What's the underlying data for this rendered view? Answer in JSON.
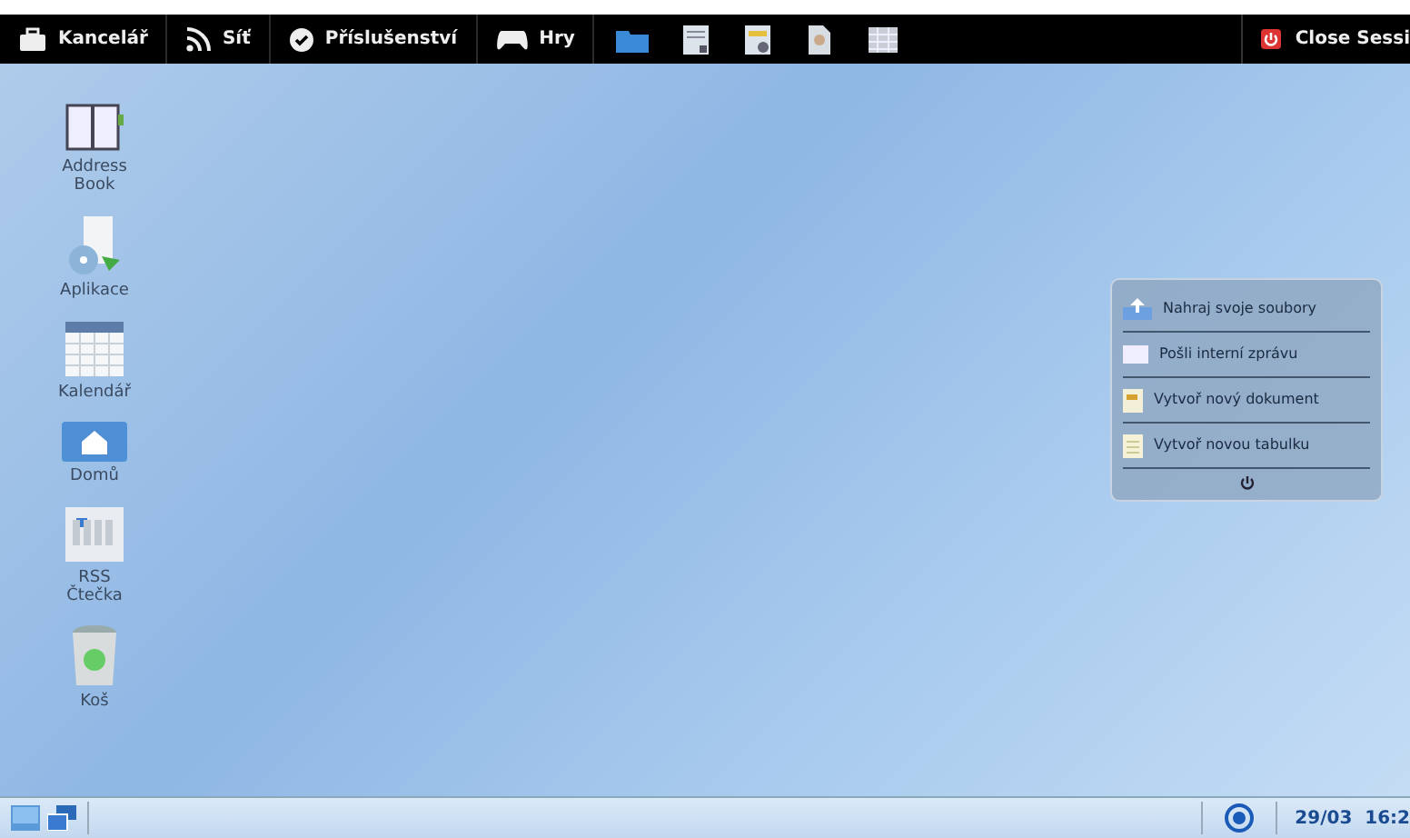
{
  "top_bar": {
    "menus": [
      {
        "label": "Kancelář",
        "kind": "case"
      },
      {
        "label": "Síť",
        "kind": "rss"
      },
      {
        "label": "Příslušenství",
        "kind": "check"
      },
      {
        "label": "Hry",
        "kind": "gamepad"
      }
    ],
    "launchers": [
      {
        "kind": "folder"
      },
      {
        "kind": "doc"
      },
      {
        "kind": "image"
      },
      {
        "kind": "person"
      },
      {
        "kind": "grid"
      }
    ],
    "close_session": "Close Sessi"
  },
  "desktop_icons": [
    {
      "label": "Address\nBook",
      "kind": "book"
    },
    {
      "label": "Aplikace",
      "kind": "apps"
    },
    {
      "label": "Kalendář",
      "kind": "calendar"
    },
    {
      "label": "Domů",
      "kind": "home"
    },
    {
      "label": "RSS\nČtečka",
      "kind": "news"
    },
    {
      "label": "Koš",
      "kind": "trash"
    }
  ],
  "widget": {
    "items": [
      {
        "label": "Nahraj svoje soubory",
        "kind": "upload"
      },
      {
        "label": "Pošli interní zprávu",
        "kind": "mail"
      },
      {
        "label": "Vytvoř nový dokument",
        "kind": "doc"
      },
      {
        "label": "Vytvoř novou tabulku",
        "kind": "sheet"
      }
    ]
  },
  "bottom_bar": {
    "clock": "29/03  16:2"
  }
}
